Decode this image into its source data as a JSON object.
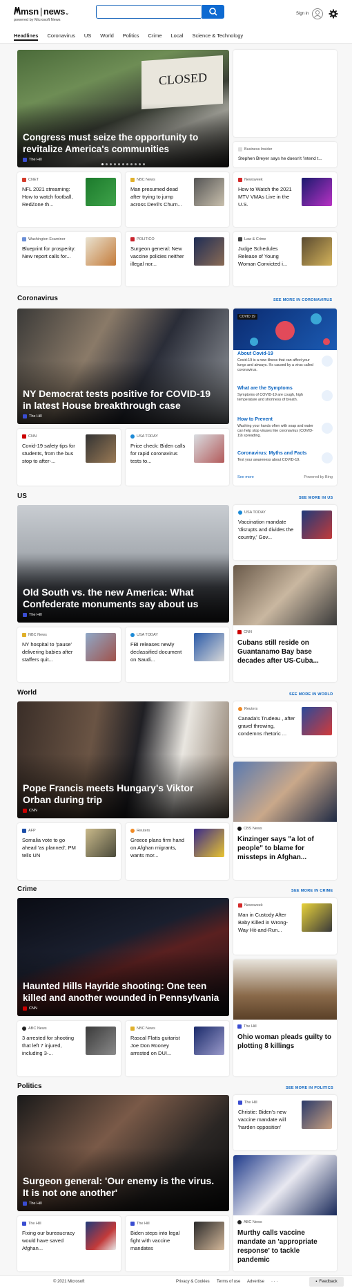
{
  "header": {
    "logo_msn": "msn",
    "logo_news": "news",
    "powered_by": "powered by Microsoft News",
    "search_value": "",
    "sign_in": "Sign in"
  },
  "nav": [
    "Headlines",
    "Coronavirus",
    "US",
    "World",
    "Politics",
    "Crime",
    "Local",
    "Science & Technology"
  ],
  "top": {
    "hero": {
      "title": "Congress must seize the opportunity to revitalize America's communities",
      "source": "The Hill"
    },
    "side_card": {
      "source": "Business Insider",
      "title": "Stephen Breyer says he doesn't 'intend t..."
    },
    "row1": [
      {
        "source": "CNET",
        "title": "NFL 2021 streaming: How to watch football, RedZone th..."
      },
      {
        "source": "NBC News",
        "title": "Man presumed dead after trying to jump across Devil's Churn..."
      },
      {
        "source": "Newsweek",
        "title": "How to Watch the 2021 MTV VMAs Live in the U.S."
      }
    ],
    "row2": [
      {
        "source": "Washington Examiner",
        "title": "Blueprint for prosperity: New report calls for..."
      },
      {
        "source": "POLITICO",
        "title": "Surgeon general: New vaccine policies neither illegal nor..."
      },
      {
        "source": "Law & Crime",
        "title": "Judge Schedules Release of Young Woman Convicted i..."
      }
    ]
  },
  "coronavirus": {
    "title": "Coronavirus",
    "see_more": "SEE MORE IN CORONAVIRUS",
    "hero": {
      "title": "NY Democrat tests positive for COVID-19 in latest House breakthrough case",
      "source": "The Hill"
    },
    "cards": [
      {
        "source": "CNN",
        "title": "Covid-19 safety tips for students, from the bus stop to after-..."
      },
      {
        "source": "USA TODAY",
        "title": "Price check: Biden calls for rapid coronavirus tests to..."
      }
    ],
    "widget": {
      "tag": "COVID 19",
      "items": [
        {
          "h": "About Covid-19",
          "b": "Covid-19 is a new illness that can affect your lungs and airways. It's caused by a virus called coronavirus."
        },
        {
          "h": "What are the Symptoms",
          "b": "Symptoms of COVID-19 are cough, high temperature and shortness of breath."
        },
        {
          "h": "How to Prevent",
          "b": "Washing your hands often with soap and water can help stop viruses like coronavirus (COVID-19) spreading."
        },
        {
          "h": "Coronavirus: Myths and Facts",
          "b": "Test your awareness about COVID-19."
        }
      ],
      "see_more": "See more",
      "powered": "Powered by Bing"
    }
  },
  "us": {
    "title": "US",
    "see_more": "SEE MORE IN US",
    "hero": {
      "title": "Old South vs. the new America: What Confederate monuments say about us",
      "source": "The Hill"
    },
    "side_card": {
      "source": "USA TODAY",
      "title": "Vaccination mandate 'disrupts and divides the country,' Gov..."
    },
    "cards": [
      {
        "source": "NBC News",
        "title": "NY hospital to 'pause' delivering babies after staffers quit..."
      },
      {
        "source": "USA TODAY",
        "title": "FBI releases newly declassified document on Saudi..."
      }
    ],
    "tall_card": {
      "source": "CNN",
      "title": "Cubans still reside on Guantanamo Bay base decades after US-Cuba..."
    }
  },
  "world": {
    "title": "World",
    "see_more": "SEE MORE IN WORLD",
    "hero": {
      "title": "Pope Francis meets Hungary's Viktor Orban during trip",
      "source": "CNN"
    },
    "side_card": {
      "source": "Reuters",
      "title": "Canada's Trudeau , after gravel throwing, condemns rhetoric ..."
    },
    "cards": [
      {
        "source": "AFP",
        "title": "Somalia vote to go ahead 'as planned', PM tells UN"
      },
      {
        "source": "Reuters",
        "title": "Greece plans firm hand on Afghan migrants, wants mor..."
      }
    ],
    "tall_card": {
      "source": "CBS News",
      "title": "Kinzinger says \"a lot of people\" to blame for missteps in Afghan..."
    }
  },
  "crime": {
    "title": "Crime",
    "see_more": "SEE MORE IN CRIME",
    "hero": {
      "title": "Haunted Hills Hayride shooting: One teen killed and another wounded in Pennsylvania",
      "source": "CNN"
    },
    "side_card": {
      "source": "Newsweek",
      "title": "Man in Custody After Baby Killed in Wrong-Way Hit-and-Run..."
    },
    "cards": [
      {
        "source": "ABC News",
        "title": "3 arrested for shooting that left 7 injured, including 3-..."
      },
      {
        "source": "NBC News",
        "title": "Rascal Flatts guitarist Joe Don Rooney arrested on DUI..."
      }
    ],
    "tall_card": {
      "source": "The Hill",
      "title": "Ohio woman pleads guilty to plotting 8 killings"
    }
  },
  "politics": {
    "title": "Politics",
    "see_more": "SEE MORE IN POLITICS",
    "hero": {
      "title": "Surgeon general: 'Our enemy is the virus. It is not one another'",
      "source": "The Hill"
    },
    "side_card": {
      "source": "The Hill",
      "title": "Christie: Biden's new vaccine mandate will 'harden opposition'"
    },
    "cards": [
      {
        "source": "The Hill",
        "title": "Fixing our bureaucracy would have saved Afghan..."
      },
      {
        "source": "The Hill",
        "title": "Biden steps into legal fight with vaccine mandates"
      }
    ],
    "tall_card": {
      "source": "ABC News",
      "title": "Murthy calls vaccine mandate an 'appropriate response' to tackle pandemic"
    }
  },
  "footer": {
    "copyright": "© 2021 Microsoft",
    "privacy": "Privacy & Cookies",
    "terms": "Terms of use",
    "advertise": "Advertise",
    "more": "· · ·",
    "feedback": "Feedback"
  },
  "colors": {
    "accent": "#0e6ad1",
    "link": "#0b64c0"
  }
}
